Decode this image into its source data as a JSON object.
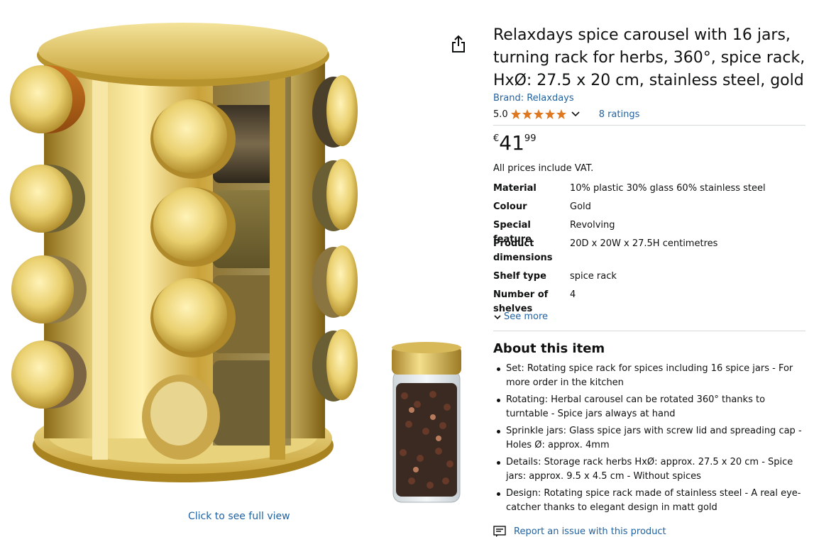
{
  "product": {
    "title": "Relaxdays spice carousel with 16 jars, turning rack for herbs, 360°, spice rack, HxØ: 27.5 x 20 cm, stainless steel, gold",
    "brand": "Brand: Relaxdays",
    "rating_value": "5.0",
    "stars": 5,
    "ratings_count": "8 ratings",
    "price_symbol": "€",
    "price_whole": "41",
    "price_fraction": "99",
    "vat_note": "All prices include VAT."
  },
  "media": {
    "full_view_link": "Click to see full view",
    "icons": {
      "share": "share-icon",
      "star": "star-icon",
      "chevron": "chevron-down-icon",
      "report": "report-icon"
    },
    "colors": {
      "link": "#2162a1",
      "star": "#de7921",
      "gold": "#d9b84a"
    }
  },
  "specs": [
    {
      "key": "Material",
      "value": "10% plastic 30% glass 60% stainless steel"
    },
    {
      "key": "Colour",
      "value": "Gold"
    },
    {
      "key": "Special feature",
      "value": "Revolving"
    },
    {
      "key": "Product dimensions",
      "value": "20D x 20W x 27.5H centimetres"
    },
    {
      "key": "Shelf type",
      "value": "spice rack"
    },
    {
      "key": "Number of shelves",
      "value": "4"
    }
  ],
  "see_more": "See more",
  "about": {
    "title": "About this item",
    "bullets": [
      "Set: Rotating spice rack for spices including 16 spice jars - For more order in the kitchen",
      "Rotating: Herbal carousel can be rotated 360° thanks to turntable - Spice jars always at hand",
      "Sprinkle jars: Glass spice jars with screw lid and spreading cap - Holes Ø: approx. 4mm",
      "Details: Storage rack herbs HxØ: approx. 27.5 x 20 cm - Spice jars: approx. 9.5 x 4.5 cm - Without spices",
      "Design: Rotating spice rack made of stainless steel - A real eye-catcher thanks to elegant design in matt gold"
    ]
  },
  "report_link": "Report an issue with this product"
}
